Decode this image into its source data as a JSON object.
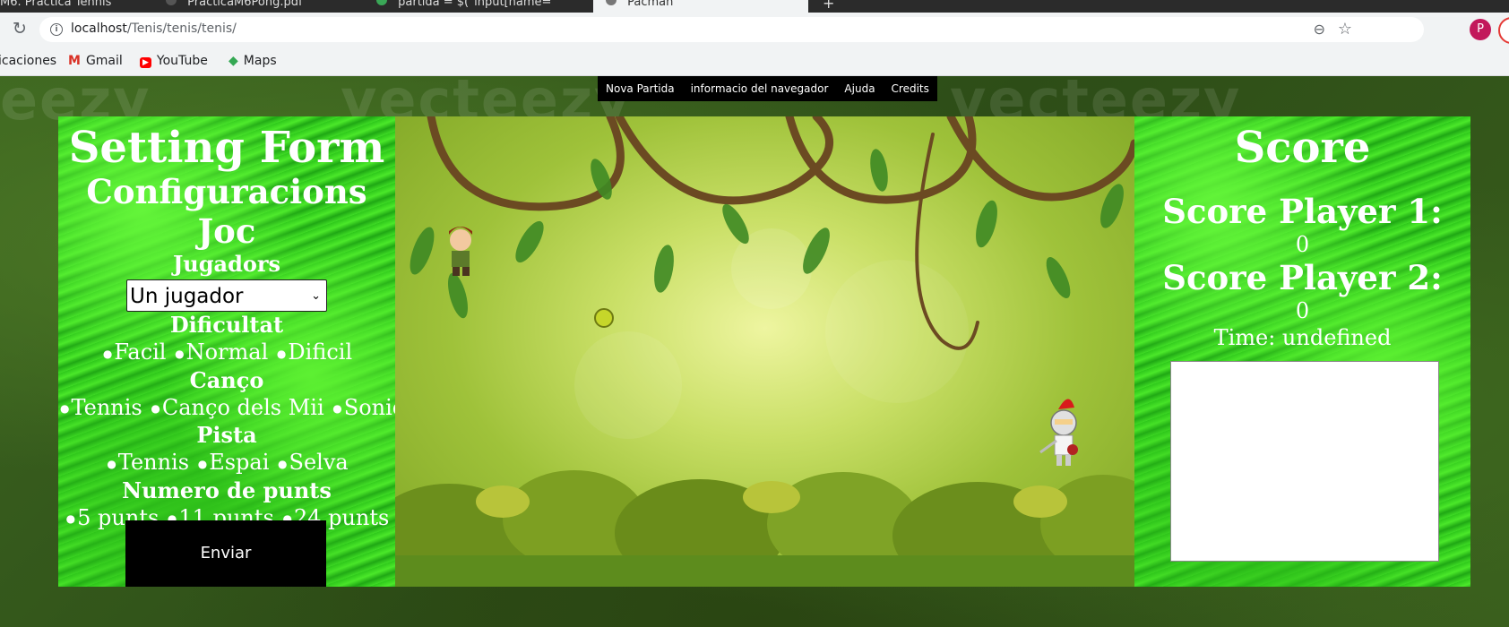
{
  "browser": {
    "tabs": [
      {
        "title": "M6. Pràctica Tennis"
      },
      {
        "title": "PracticaM6Pong.pdf"
      },
      {
        "title": "partida = $(\"input[name="
      },
      {
        "title": "Pacman"
      }
    ],
    "url_host": "localhost",
    "url_path": "/Tenis/tenis/tenis/",
    "profile_letter": "P",
    "bookmarks": [
      {
        "label": "icaciones",
        "icon": "apps-icon"
      },
      {
        "label": "Gmail",
        "icon": "gmail-icon"
      },
      {
        "label": "YouTube",
        "icon": "youtube-icon"
      },
      {
        "label": "Maps",
        "icon": "maps-icon"
      }
    ]
  },
  "menu": {
    "items": [
      "Nova Partida",
      "informacio del navegador",
      "Ajuda",
      "Credits"
    ]
  },
  "settings": {
    "title": "Setting Form",
    "subtitle": "Configuracions Joc",
    "players_label": "Jugadors",
    "players_selected": "Un jugador",
    "difficulty_label": "Dificultat",
    "difficulty_options": [
      "Facil",
      "Normal",
      "Dificil"
    ],
    "song_label": "Canço",
    "song_options": [
      "Tennis",
      "Canço dels Mii",
      "Sonic"
    ],
    "court_label": "Pista",
    "court_options": [
      "Tennis",
      "Espai",
      "Selva"
    ],
    "points_label": "Numero de punts",
    "points_options": [
      "5 punts",
      "11 punts",
      "24 punts"
    ],
    "submit_label": "Enviar"
  },
  "score": {
    "title": "Score",
    "player1_label": "Score Player 1:",
    "player1_value": "0",
    "player2_label": "Score Player 2:",
    "player2_value": "0",
    "time_text": "Time: undefined"
  },
  "game": {
    "background": "jungle",
    "player1_sprite": "adventurer-sprite",
    "player2_sprite": "knight-sprite",
    "ball": "tennis-ball"
  },
  "colors": {
    "panel_green": "#2cc21a",
    "menu_bg": "#000000",
    "text": "#ffffff"
  }
}
